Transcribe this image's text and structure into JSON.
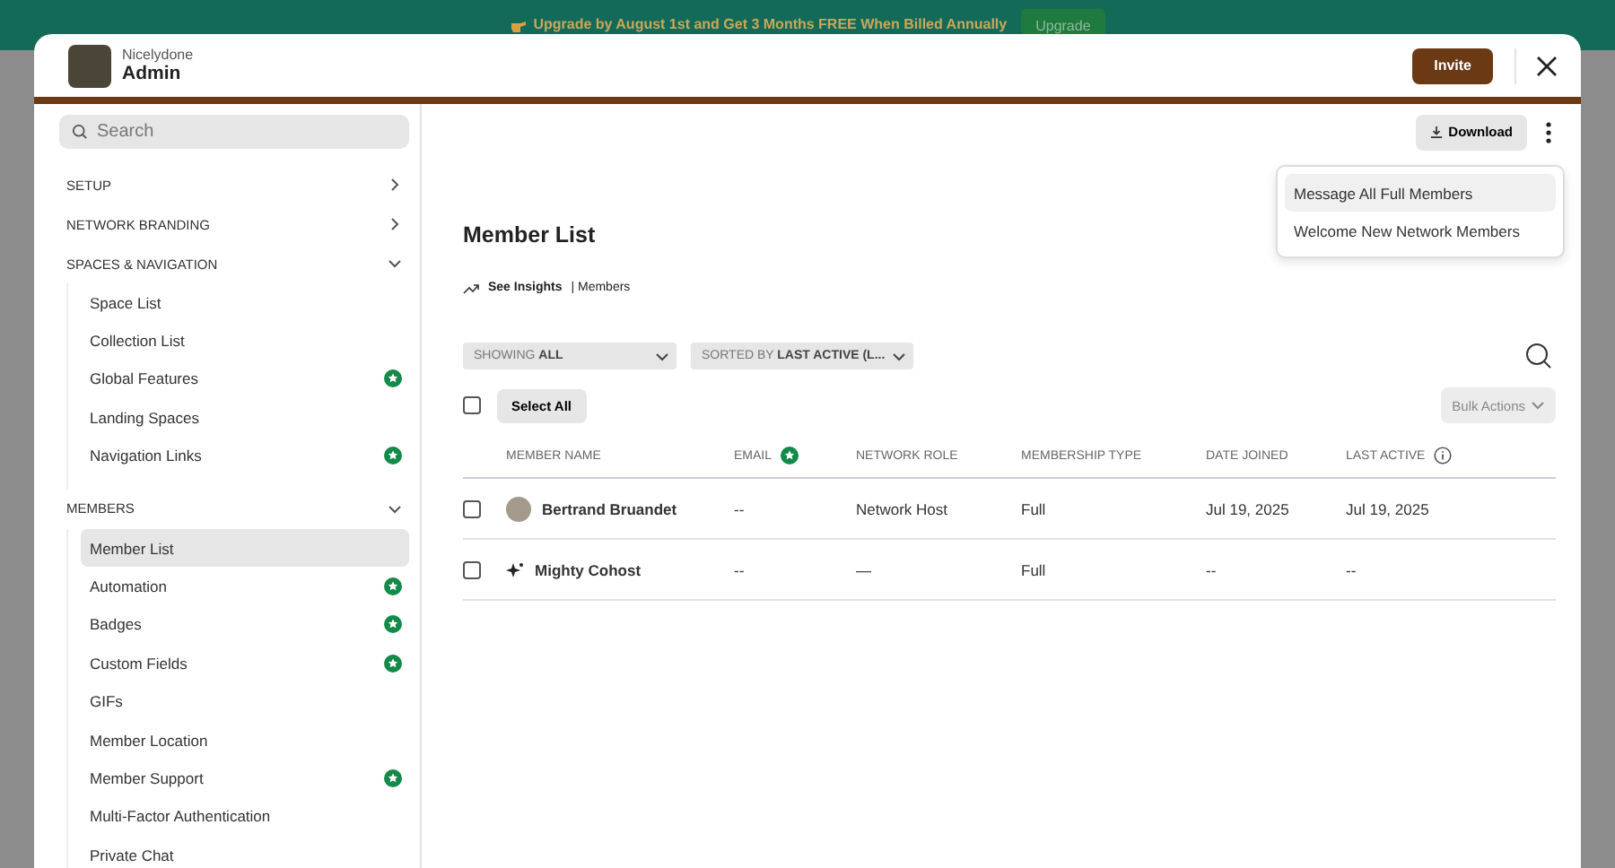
{
  "banner": {
    "text": "Upgrade by August 1st and Get 3 Months FREE When Billed Annually",
    "button": "Upgrade"
  },
  "header": {
    "network": "Nicelydone",
    "title": "Admin",
    "invite": "Invite"
  },
  "sidebar": {
    "search": {
      "placeholder": "Search"
    },
    "sections": [
      {
        "label": "SETUP",
        "expanded": false
      },
      {
        "label": "NETWORK BRANDING",
        "expanded": false
      },
      {
        "label": "SPACES & NAVIGATION",
        "expanded": true,
        "items": [
          {
            "label": "Space List",
            "selected": false,
            "premium": false
          },
          {
            "label": "Collection List",
            "selected": false,
            "premium": false
          },
          {
            "label": "Global Features",
            "selected": false,
            "premium": true
          },
          {
            "label": "Landing Spaces",
            "selected": false,
            "premium": false
          },
          {
            "label": "Navigation Links",
            "selected": false,
            "premium": true
          }
        ]
      },
      {
        "label": "MEMBERS",
        "expanded": true,
        "items": [
          {
            "label": "Member List",
            "selected": true,
            "premium": false
          },
          {
            "label": "Automation",
            "selected": false,
            "premium": true
          },
          {
            "label": "Badges",
            "selected": false,
            "premium": true
          },
          {
            "label": "Custom Fields",
            "selected": false,
            "premium": true
          },
          {
            "label": "GIFs",
            "selected": false,
            "premium": false
          },
          {
            "label": "Member Location",
            "selected": false,
            "premium": false
          },
          {
            "label": "Member Support",
            "selected": false,
            "premium": true
          },
          {
            "label": "Multi-Factor Authentication",
            "selected": false,
            "premium": false
          },
          {
            "label": "Private Chat",
            "selected": false,
            "premium": false
          }
        ]
      }
    ]
  },
  "main": {
    "download": "Download",
    "menu": [
      {
        "label": "Message All Full Members",
        "selected": true
      },
      {
        "label": "Welcome New Network Members",
        "selected": false
      }
    ],
    "title": "Member List",
    "insights": {
      "link": "See Insights",
      "context": "| Members"
    },
    "filters": [
      "SHOWING **ALL**",
      "SORTED BY **LAST ACTIVE (L...**"
    ],
    "select_all": {
      "checked": false,
      "label": "Select All"
    },
    "bulk_actions": "Bulk Actions",
    "table": {
      "columns": [
        {
          "label": "MEMBER NAME",
          "premium": false,
          "info": false
        },
        {
          "label": "EMAIL",
          "premium": true,
          "info": false
        },
        {
          "label": "NETWORK ROLE",
          "premium": false,
          "info": false
        },
        {
          "label": "MEMBERSHIP TYPE",
          "premium": false,
          "info": false
        },
        {
          "label": "DATE JOINED",
          "premium": false,
          "info": false
        },
        {
          "label": "LAST ACTIVE",
          "premium": false,
          "info": true
        }
      ],
      "rows": [
        {
          "checked": false,
          "kind": "photo",
          "name": "Bertrand Bruandet",
          "email": "--",
          "role": "Network Host",
          "type": "Full",
          "joined": "Jul 19, 2025",
          "active": "Jul 19, 2025"
        },
        {
          "checked": false,
          "kind": "bot",
          "name": "Mighty Cohost",
          "email": "--",
          "role": "—",
          "type": "Full",
          "joined": "--",
          "active": "--"
        }
      ]
    }
  }
}
